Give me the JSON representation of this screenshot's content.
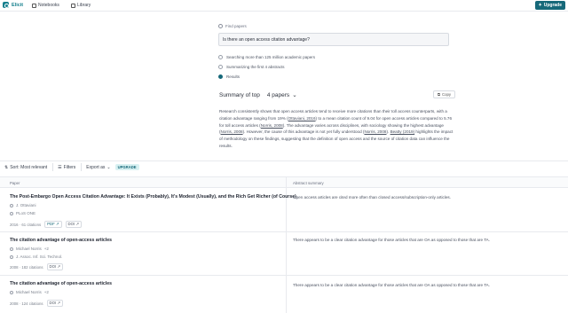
{
  "nav": {
    "logo": "Elicit",
    "items": [
      "Notebooks",
      "Library"
    ],
    "upgrade": "Upgrade"
  },
  "query": {
    "find_label": "Find papers",
    "value": "Is there an open access citation advantage?",
    "steps": [
      "Searching more than 125 million academic papers",
      "Summarizing the first 4 abstracts",
      "Results"
    ]
  },
  "summary": {
    "title": "Summary of top",
    "count": "4 papers",
    "copy": "Copy",
    "text_parts": [
      "Research consistently shows that open access articles tend to receive more citations than their toll access counterparts, with a citation advantage ranging from 19% (",
      "Ottaviani, 2016",
      ") to a mean citation count of 9.04 for open access articles compared to 5.76 for toll access articles (",
      "Norris, 2008",
      "). The advantage varies across disciplines, with sociology showing the highest advantage (",
      "Norris, 2008",
      "). However, the cause of this advantage is not yet fully understood (",
      "Norris, 2008",
      "). ",
      "Beatty (2019)",
      " highlights the impact of methodology on these findings, suggesting that the definition of open access and the source of citation data can influence the results."
    ]
  },
  "toolbar": {
    "sort": "Sort: Most relevant",
    "filters": "Filters",
    "export": "Export as",
    "badge": "UPGRADE"
  },
  "table": {
    "col_paper": "Paper",
    "col_abstract": "Abstract summary",
    "rows": [
      {
        "title": "The Post-Embargo Open Access Citation Advantage: It Exists (Probably), It's Modest (Usually), and the Rich Get Richer (of Course)",
        "author": "J. Ottaviani",
        "venue": "PLoS ONE",
        "year_citations": "2016 · 61 citations",
        "chip1": "PDF",
        "chip2": "DOI",
        "abstract": "Open access articles are cited more often than closed access/subscription-only articles."
      },
      {
        "title": "The citation advantage of open-access articles",
        "author": "Michael Norris",
        "author_extra": "+2",
        "venue": "J. Assoc. Inf. Sci. Technol.",
        "year_citations": "2008 · 182 citations",
        "chip2": "DOI",
        "abstract": "There appears to be a clear citation advantage for those articles that are OA as opposed to those that are TA."
      },
      {
        "title": "The citation advantage of open-access articles",
        "author": "Michael Norris",
        "author_extra": "+2",
        "year_citations": "2008 · 124 citations",
        "chip2": "DOI",
        "abstract": "There appears to be a clear citation advantage for those articles that are OA as opposed to those that are TA."
      }
    ]
  }
}
